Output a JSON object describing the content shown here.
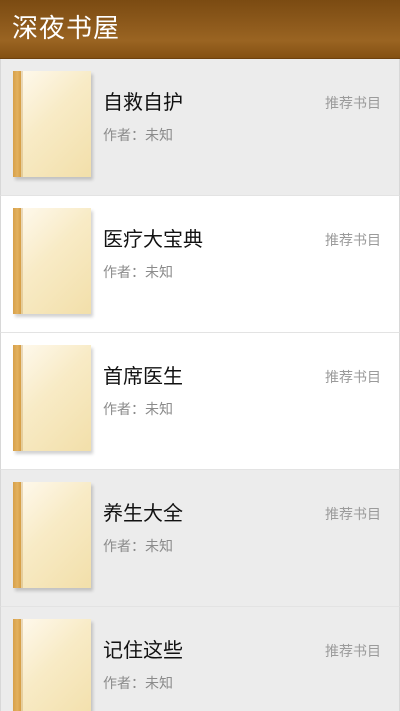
{
  "header": {
    "title": "深夜书屋"
  },
  "books": [
    {
      "title": "自救自护",
      "author_label": "作者：未知",
      "tag": "推荐书目"
    },
    {
      "title": "医疗大宝典",
      "author_label": "作者：未知",
      "tag": "推荐书目"
    },
    {
      "title": "首席医生",
      "author_label": "作者：未知",
      "tag": "推荐书目"
    },
    {
      "title": "养生大全",
      "author_label": "作者：未知",
      "tag": "推荐书目"
    },
    {
      "title": "记住这些",
      "author_label": "作者：未知",
      "tag": "推荐书目"
    }
  ],
  "colors": {
    "header_brown": "#8a571a",
    "row_gray": "#ececec",
    "row_white": "#ffffff",
    "book_spine": "#d7a04a"
  },
  "icons": {
    "book_cover": "book-cover-icon"
  }
}
